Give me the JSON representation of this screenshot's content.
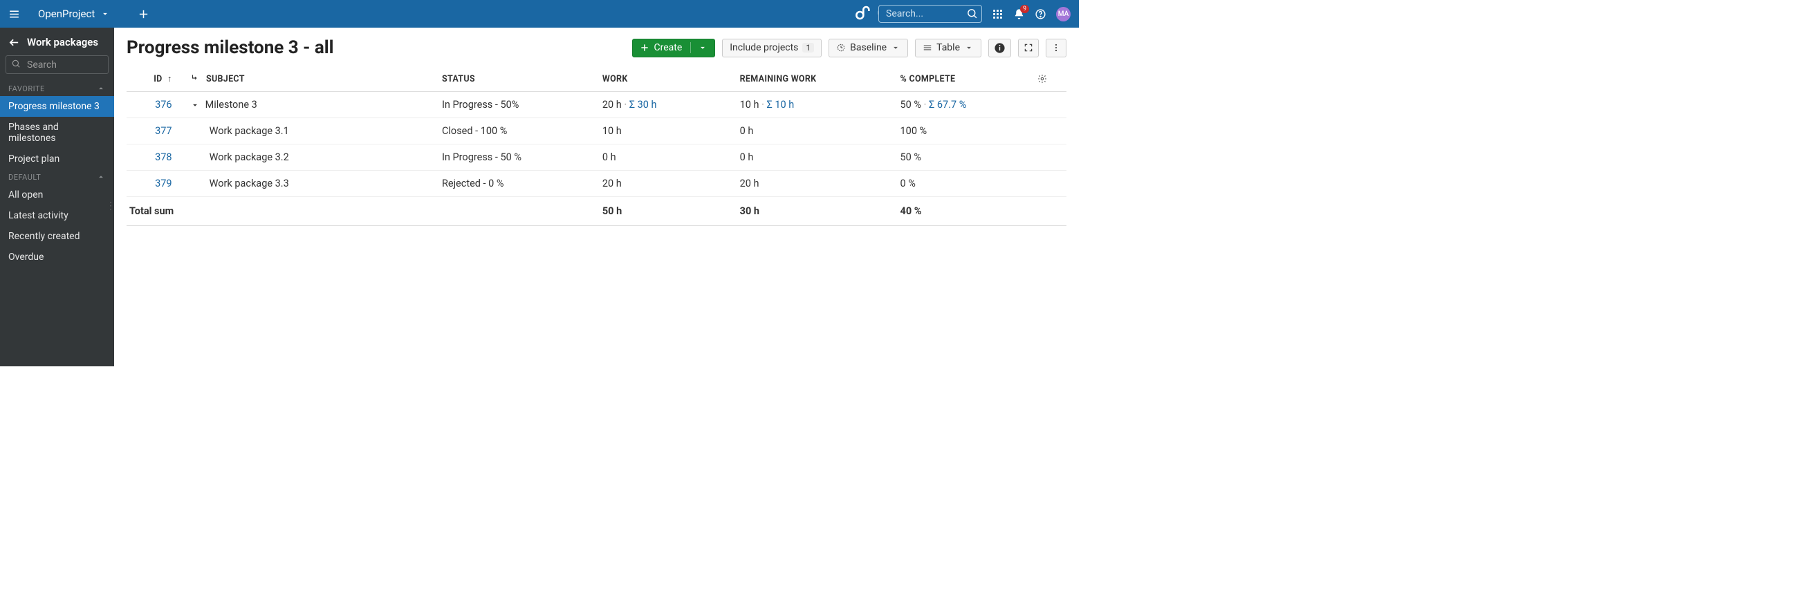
{
  "topbar": {
    "project_name": "OpenProject",
    "brand": "OpenProject",
    "search_placeholder": "Search...",
    "notif_count": "9",
    "avatar_initials": "MA"
  },
  "sidebar": {
    "back_label": "Work packages",
    "search_placeholder": "Search",
    "sections": {
      "favorite": {
        "label": "FAVORITE",
        "items": [
          "Progress milestone 3",
          "Phases and milestones",
          "Project plan"
        ]
      },
      "default": {
        "label": "DEFAULT",
        "items": [
          "All open",
          "Latest activity",
          "Recently created",
          "Overdue"
        ]
      }
    }
  },
  "main": {
    "title": "Progress milestone 3 - all",
    "create_label": "Create",
    "include_label": "Include projects",
    "include_count": "1",
    "baseline_label": "Baseline",
    "view_label": "Table",
    "columns": {
      "id": "ID",
      "subject": "SUBJECT",
      "status": "STATUS",
      "work": "WORK",
      "remaining": "REMAINING WORK",
      "complete": "% COMPLETE"
    },
    "rows": [
      {
        "id": "376",
        "subject": "Milestone 3",
        "status": "In Progress - 50%",
        "work": "20 h",
        "work_sum": "Σ 30 h",
        "remaining": "10 h",
        "remaining_sum": "Σ 10 h",
        "complete": "50 %",
        "complete_sum": "Σ 67.7 %",
        "parent": true
      },
      {
        "id": "377",
        "subject": "Work package 3.1",
        "status": "Closed - 100 %",
        "work": "10 h",
        "remaining": "0 h",
        "complete": "100 %"
      },
      {
        "id": "378",
        "subject": "Work package 3.2",
        "status": "In Progress - 50 %",
        "work": "0 h",
        "remaining": "0 h",
        "complete": "50 %"
      },
      {
        "id": "379",
        "subject": "Work package 3.3",
        "status": "Rejected - 0 %",
        "work": "20 h",
        "remaining": "20 h",
        "complete": "0 %"
      }
    ],
    "total": {
      "label": "Total sum",
      "work": "50 h",
      "remaining": "30 h",
      "complete": "40 %"
    }
  }
}
